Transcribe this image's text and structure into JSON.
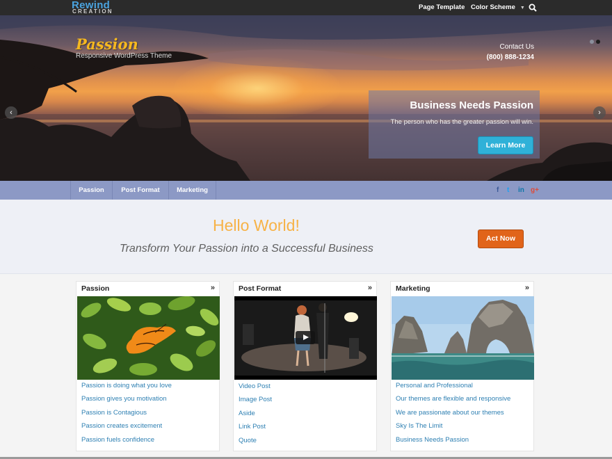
{
  "topbar": {
    "logo_main": "Rewind",
    "logo_sub": "CREATION",
    "nav": [
      "Page Template",
      "Color Scheme"
    ],
    "search_icon": "search-icon"
  },
  "hero": {
    "site_name": "Passion",
    "tagline": "Responsive WordPress Theme",
    "contact_label": "Contact Us",
    "phone": "(800) 888-1234",
    "slide": {
      "heading": "Business Needs Passion",
      "text": "The person who has the greater passion will win.",
      "button": "Learn More"
    }
  },
  "mainnav": {
    "items": [
      "Passion",
      "Post Format",
      "Marketing"
    ],
    "social": [
      {
        "icon": "facebook-icon",
        "glyph": "f",
        "color": "#3b5998"
      },
      {
        "icon": "twitter-icon",
        "glyph": "t",
        "color": "#1da1f2"
      },
      {
        "icon": "linkedin-icon",
        "glyph": "in",
        "color": "#0e76a8"
      },
      {
        "icon": "google-plus-icon",
        "glyph": "g+",
        "color": "#dd4b39"
      }
    ]
  },
  "intro": {
    "title": "Hello World!",
    "subtitle": "Transform Your Passion into a Successful Business",
    "button": "Act Now"
  },
  "widgets": [
    {
      "title": "Passion",
      "more": "»",
      "links": [
        "Passion is doing what you love",
        "Passion gives you motivation",
        "Passion is Contagious",
        "Passion creates excitement",
        "Passion fuels confidence"
      ]
    },
    {
      "title": "Post Format",
      "more": "»",
      "links": [
        "Video Post",
        "Image Post",
        "Aside",
        "Link Post",
        "Quote"
      ]
    },
    {
      "title": "Marketing",
      "more": "»",
      "links": [
        "Personal and Professional",
        "Our themes are flexible and responsive",
        "We are passionate about our themes",
        "Sky Is The Limit",
        "Business Needs Passion"
      ]
    }
  ],
  "colors": {
    "accent_blue": "#2fb1d8",
    "accent_orange": "#e1641a",
    "brand_yellow": "#f6b81f",
    "nav_bar": "#8c99c5",
    "link": "#2d7fb2"
  }
}
